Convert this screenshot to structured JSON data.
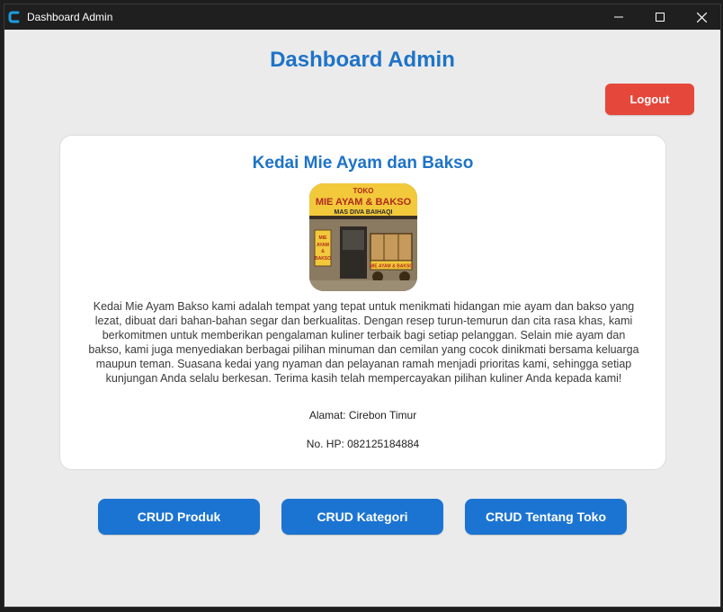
{
  "window": {
    "title": "Dashboard Admin",
    "icon": "app-c-icon",
    "controls": [
      "minimize-icon",
      "maximize-icon",
      "close-icon"
    ]
  },
  "header": {
    "title": "Dashboard Admin",
    "logout_label": "Logout"
  },
  "store": {
    "name": "Kedai Mie Ayam dan Bakso",
    "image_sign": {
      "line1": "TOKO",
      "line2": "MIE AYAM & BAKSO",
      "line3": "MAS DIVA BAIHAQI",
      "side1": "MIE",
      "side2": "AYAM",
      "side3": "&",
      "side4": "BAKSO",
      "cart": "MIE AYAM & BAKSO"
    },
    "description": "Kedai Mie Ayam Bakso kami adalah tempat yang tepat untuk menikmati hidangan mie ayam dan bakso yang lezat, dibuat dari bahan-bahan segar dan berkualitas. Dengan resep turun-temurun dan cita rasa khas, kami berkomitmen untuk memberikan pengalaman kuliner terbaik bagi setiap pelanggan. Selain mie ayam dan bakso, kami juga menyediakan berbagai pilihan minuman dan cemilan yang cocok dinikmati bersama keluarga maupun teman. Suasana kedai yang nyaman dan pelayanan ramah menjadi prioritas kami, sehingga setiap kunjungan Anda selalu berkesan. Terima kasih telah mempercayakan pilihan kuliner Anda kepada kami!",
    "address": "Alamat: Cirebon Timur",
    "phone": "No. HP: 082125184884"
  },
  "nav": {
    "produk": "CRUD Produk",
    "kategori": "CRUD Kategori",
    "tentang_toko": "CRUD Tentang Toko"
  },
  "colors": {
    "accent": "#1e73c8",
    "button_blue": "#1c74d2",
    "logout_red": "#e5473a",
    "background": "#ebebeb",
    "card": "#ffffff",
    "titlebar": "#1f1f1f"
  }
}
